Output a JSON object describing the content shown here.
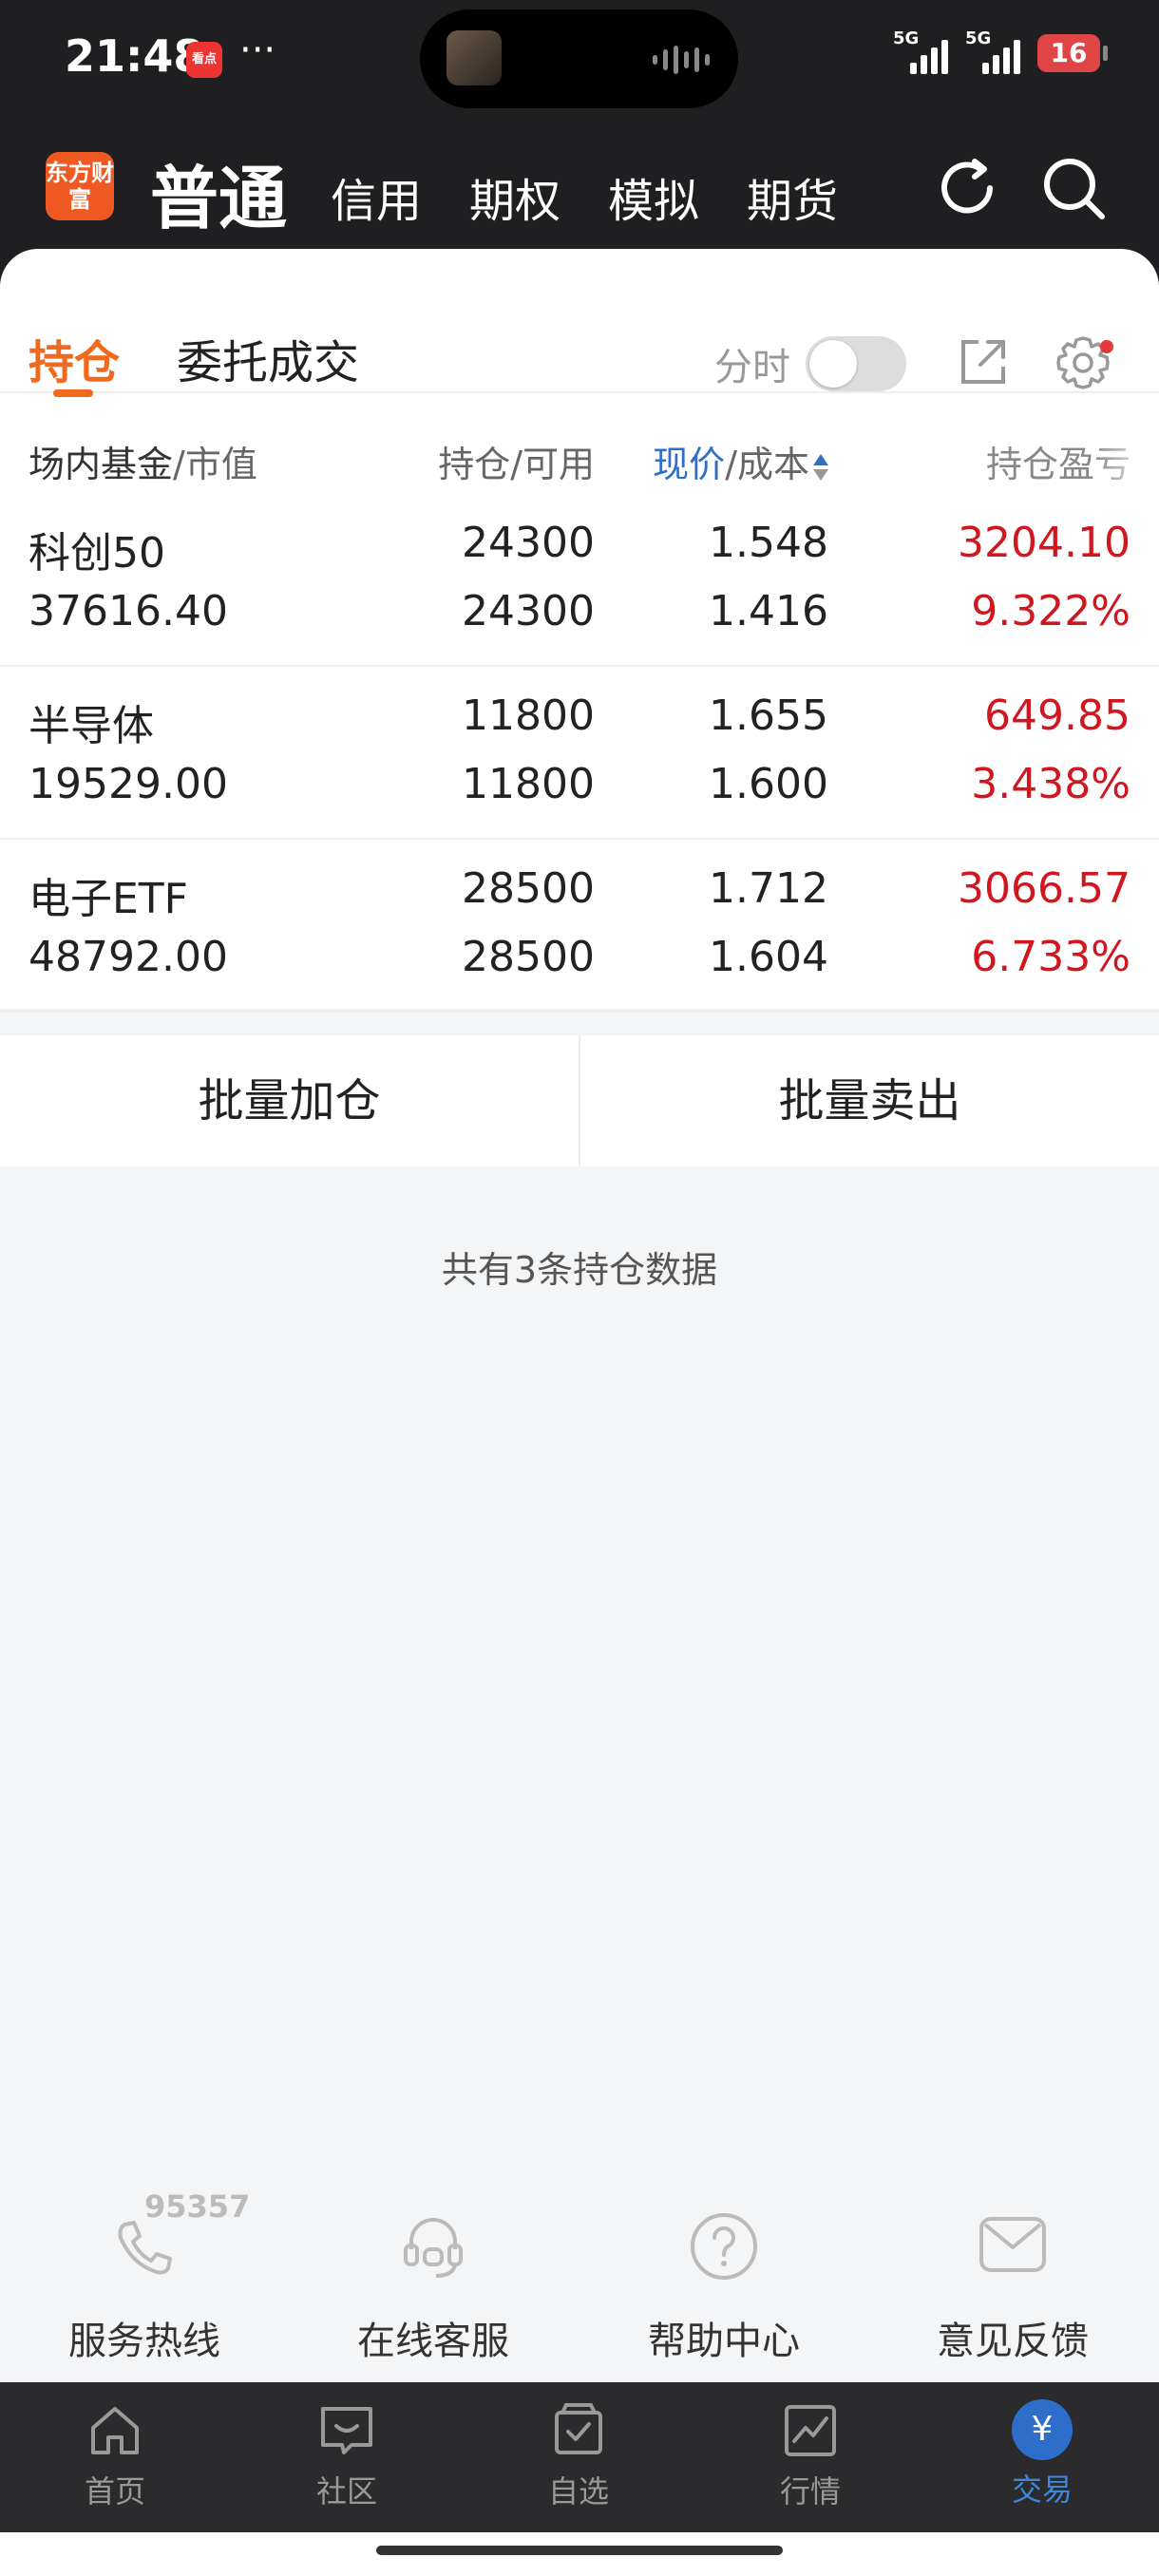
{
  "status_bar": {
    "time": "21:48",
    "app_icon_text": "看点",
    "more": "···",
    "signal1_label": "5G",
    "signal2_label": "5G",
    "battery": "16"
  },
  "header": {
    "logo_text": "东方财富",
    "active_mode": "普通",
    "modes": [
      "信用",
      "期权",
      "模拟",
      "期货"
    ]
  },
  "tabs": {
    "holdings": "持仓",
    "orders": "委托成交",
    "timeshare_label": "分时",
    "timeshare_on": false
  },
  "table": {
    "headers": {
      "name": "场内基金",
      "name_sub": "/市值",
      "position": "持仓/可用",
      "price": "现价",
      "price_sub": "/成本",
      "pnl": "持仓盈亏"
    },
    "rows": [
      {
        "name": "科创50",
        "market_value": "37616.40",
        "position": "24300",
        "available": "24300",
        "price": "1.548",
        "cost": "1.416",
        "pnl": "3204.10",
        "pnl_pct": "9.322%"
      },
      {
        "name": "半导体",
        "market_value": "19529.00",
        "position": "11800",
        "available": "11800",
        "price": "1.655",
        "cost": "1.600",
        "pnl": "649.85",
        "pnl_pct": "3.438%"
      },
      {
        "name": "电子ETF",
        "market_value": "48792.00",
        "position": "28500",
        "available": "28500",
        "price": "1.712",
        "cost": "1.604",
        "pnl": "3066.57",
        "pnl_pct": "6.733%"
      }
    ]
  },
  "batch": {
    "add": "批量加仓",
    "sell": "批量卖出"
  },
  "summary": "共有3条持仓数据",
  "services": [
    {
      "label": "服务热线",
      "icon": "phone-icon",
      "badge": "95357"
    },
    {
      "label": "在线客服",
      "icon": "headset-icon"
    },
    {
      "label": "帮助中心",
      "icon": "help-icon"
    },
    {
      "label": "意见反馈",
      "icon": "feedback-icon"
    }
  ],
  "bottom_nav": [
    {
      "label": "首页",
      "icon": "home-icon"
    },
    {
      "label": "社区",
      "icon": "community-icon"
    },
    {
      "label": "自选",
      "icon": "watchlist-icon"
    },
    {
      "label": "行情",
      "icon": "market-icon"
    },
    {
      "label": "交易",
      "icon": "trade-icon",
      "active": true,
      "icon_text": "¥"
    }
  ],
  "colors": {
    "accent": "#f06a1d",
    "loss_gain_red": "#d0161e",
    "nav_active": "#3d86d9",
    "header_bg": "#1f1f21"
  }
}
